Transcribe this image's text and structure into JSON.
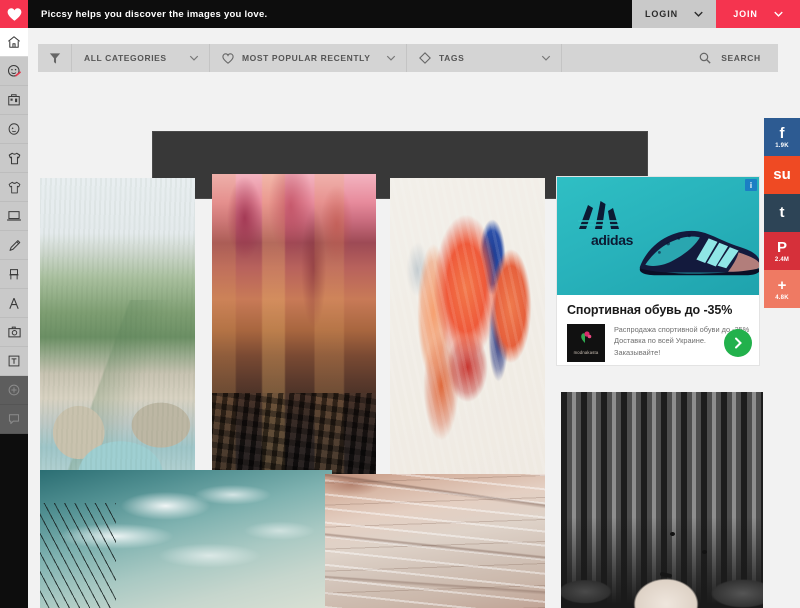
{
  "topbar": {
    "logo_icon": "heart-icon",
    "tagline": "Piccsy helps you discover the images you love.",
    "login_label": "LOGIN",
    "join_label": "JOIN",
    "login_bg": "#c9c9c9",
    "join_bg": "#f5344f",
    "bg": "#0d0d0d"
  },
  "sidebar": {
    "bg": "#c9c9c9",
    "items": [
      {
        "name": "home",
        "icon": "home-icon",
        "active": true
      },
      {
        "name": "humor",
        "icon": "smiley-pencil-icon",
        "active": false
      },
      {
        "name": "architecture",
        "icon": "building-icon",
        "active": false
      },
      {
        "name": "people",
        "icon": "face-icon",
        "active": false
      },
      {
        "name": "fashion",
        "icon": "tshirt-icon",
        "active": false
      },
      {
        "name": "style",
        "icon": "tshirt-outline-icon",
        "active": false
      },
      {
        "name": "technology",
        "icon": "laptop-icon",
        "active": false
      },
      {
        "name": "illustration",
        "icon": "pencil-icon",
        "active": false
      },
      {
        "name": "furniture",
        "icon": "chair-icon",
        "active": false
      },
      {
        "name": "typography",
        "icon": "compass-a-icon",
        "active": false
      },
      {
        "name": "photography",
        "icon": "camera-icon",
        "active": false
      },
      {
        "name": "text",
        "icon": "text-box-icon",
        "active": false
      },
      {
        "name": "more",
        "icon": "plus-circle-icon",
        "active": false
      },
      {
        "name": "feedback",
        "icon": "speech-bubble-icon",
        "active": false
      }
    ]
  },
  "filterbar": {
    "filter_icon": "funnel-icon",
    "selects": [
      {
        "icon": "",
        "label": "ALL CATEGORIES",
        "chevron": "chevron-down-icon"
      },
      {
        "icon": "heart-outline-icon",
        "label": "MOST POPULAR RECENTLY",
        "chevron": "chevron-down-icon"
      },
      {
        "icon": "tag-icon",
        "label": "TAGS",
        "chevron": "chevron-down-icon"
      }
    ],
    "search_label": "SEARCH",
    "search_icon": "search-icon",
    "bg": "#d4d4d4"
  },
  "banner_ad": {
    "name": "leaderboard-ad-placeholder",
    "bg": "#383838"
  },
  "grid": {
    "cards": [
      {
        "name": "photo-canyon-river",
        "style": "ph-canyon",
        "alt": "Aerial view of a turquoise river canyon surrounded by pine forest"
      },
      {
        "name": "photo-autumn-street",
        "style": "ph-street",
        "alt": "Rainy autumn city street with pink trees and fallen leaves"
      },
      {
        "name": "painting-portrait",
        "style": "ph-portrait",
        "alt": "Expressive orange and blue painted portrait of two faces"
      },
      {
        "name": "photo-birds-sky",
        "style": "ph-sky",
        "alt": "Birds on power lines against a cloudy teal sky"
      },
      {
        "name": "photo-rock-strata",
        "style": "ph-rock",
        "alt": "Close up of pale layered rock strata texture"
      },
      {
        "name": "photo-bw-mask",
        "style": "ph-mask",
        "alt": "Black and white photo of a pale mask against striped wallpaper"
      }
    ]
  },
  "ad_card": {
    "brand_logo_text": "adidas",
    "adchoices_label": "i",
    "title": "Спортивная обувь до -35%",
    "description": "Распродажа спортивной обуви до -35% Доставка по всей Украине. Заказывайте!",
    "advertiser": "modnakasta",
    "cta_icon": "chevron-right-icon",
    "hero_bg": "#28b2bb",
    "cta_bg": "#22b14c"
  },
  "social": {
    "items": [
      {
        "name": "facebook",
        "glyph": "f",
        "count": "1.9K",
        "color": "#2d5b92"
      },
      {
        "name": "stumbleupon",
        "glyph": "su",
        "count": "",
        "color": "#ef4a23"
      },
      {
        "name": "tumblr",
        "glyph": "t",
        "count": "",
        "color": "#2d4456"
      },
      {
        "name": "pinterest",
        "glyph": "P",
        "count": "2.4M",
        "color": "#d6303a"
      },
      {
        "name": "share-more",
        "glyph": "+",
        "count": "4.8K",
        "color": "#ef7a63"
      }
    ]
  }
}
